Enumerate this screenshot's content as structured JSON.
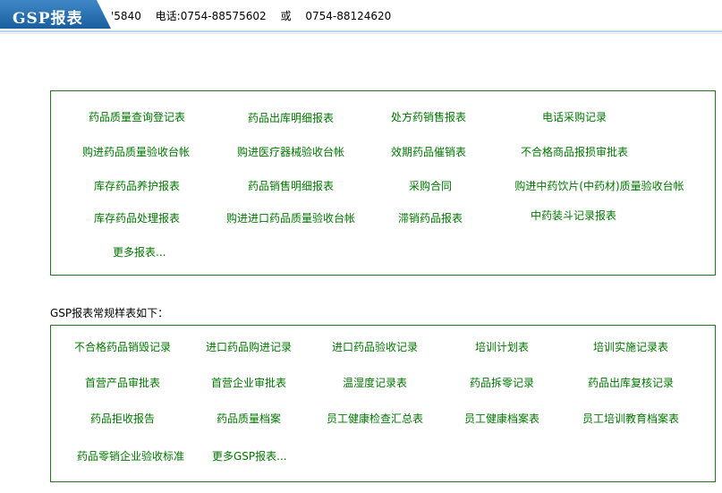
{
  "header": {
    "badge": "GSP报表",
    "code": "'5840",
    "phone_label": "电话:0754-88575602",
    "or_text": "或",
    "phone2": "0754-88124620"
  },
  "section1": {
    "items": [
      "药品质量查询登记表",
      "药品出库明细报表",
      "处方药销售报表",
      "电话采购记录",
      "购进药品质量验收台帐",
      "购进医疗器械验收台帐",
      "效期药品催销表",
      "不合格商品报损审批表",
      "库存药品养护报表",
      "药品销售明细报表",
      "采购合同",
      "购进中药饮片(中药材)质量验收台帐",
      "库存药品处理报表",
      "购进进口药品质量验收台帐",
      "滞销药品报表",
      "中药装斗记录报表"
    ],
    "more": "更多报表..."
  },
  "section2": {
    "caption": "GSP报表常规样表如下：",
    "items": [
      "不合格药品销毁记录",
      "进口药品购进记录",
      "进口药品验收记录",
      "培训计划表",
      "培训实施记录表",
      "首营产品审批表",
      "首营企业审批表",
      "温湿度记录表",
      "药品拆零记录",
      "药品出库复核记录",
      "药品拒收报告",
      "药品质量档案",
      "员工健康检查汇总表",
      "员工健康档案表",
      "员工培训教育档案表",
      "药品零销企业验收标准"
    ],
    "more": "更多GSP报表..."
  }
}
